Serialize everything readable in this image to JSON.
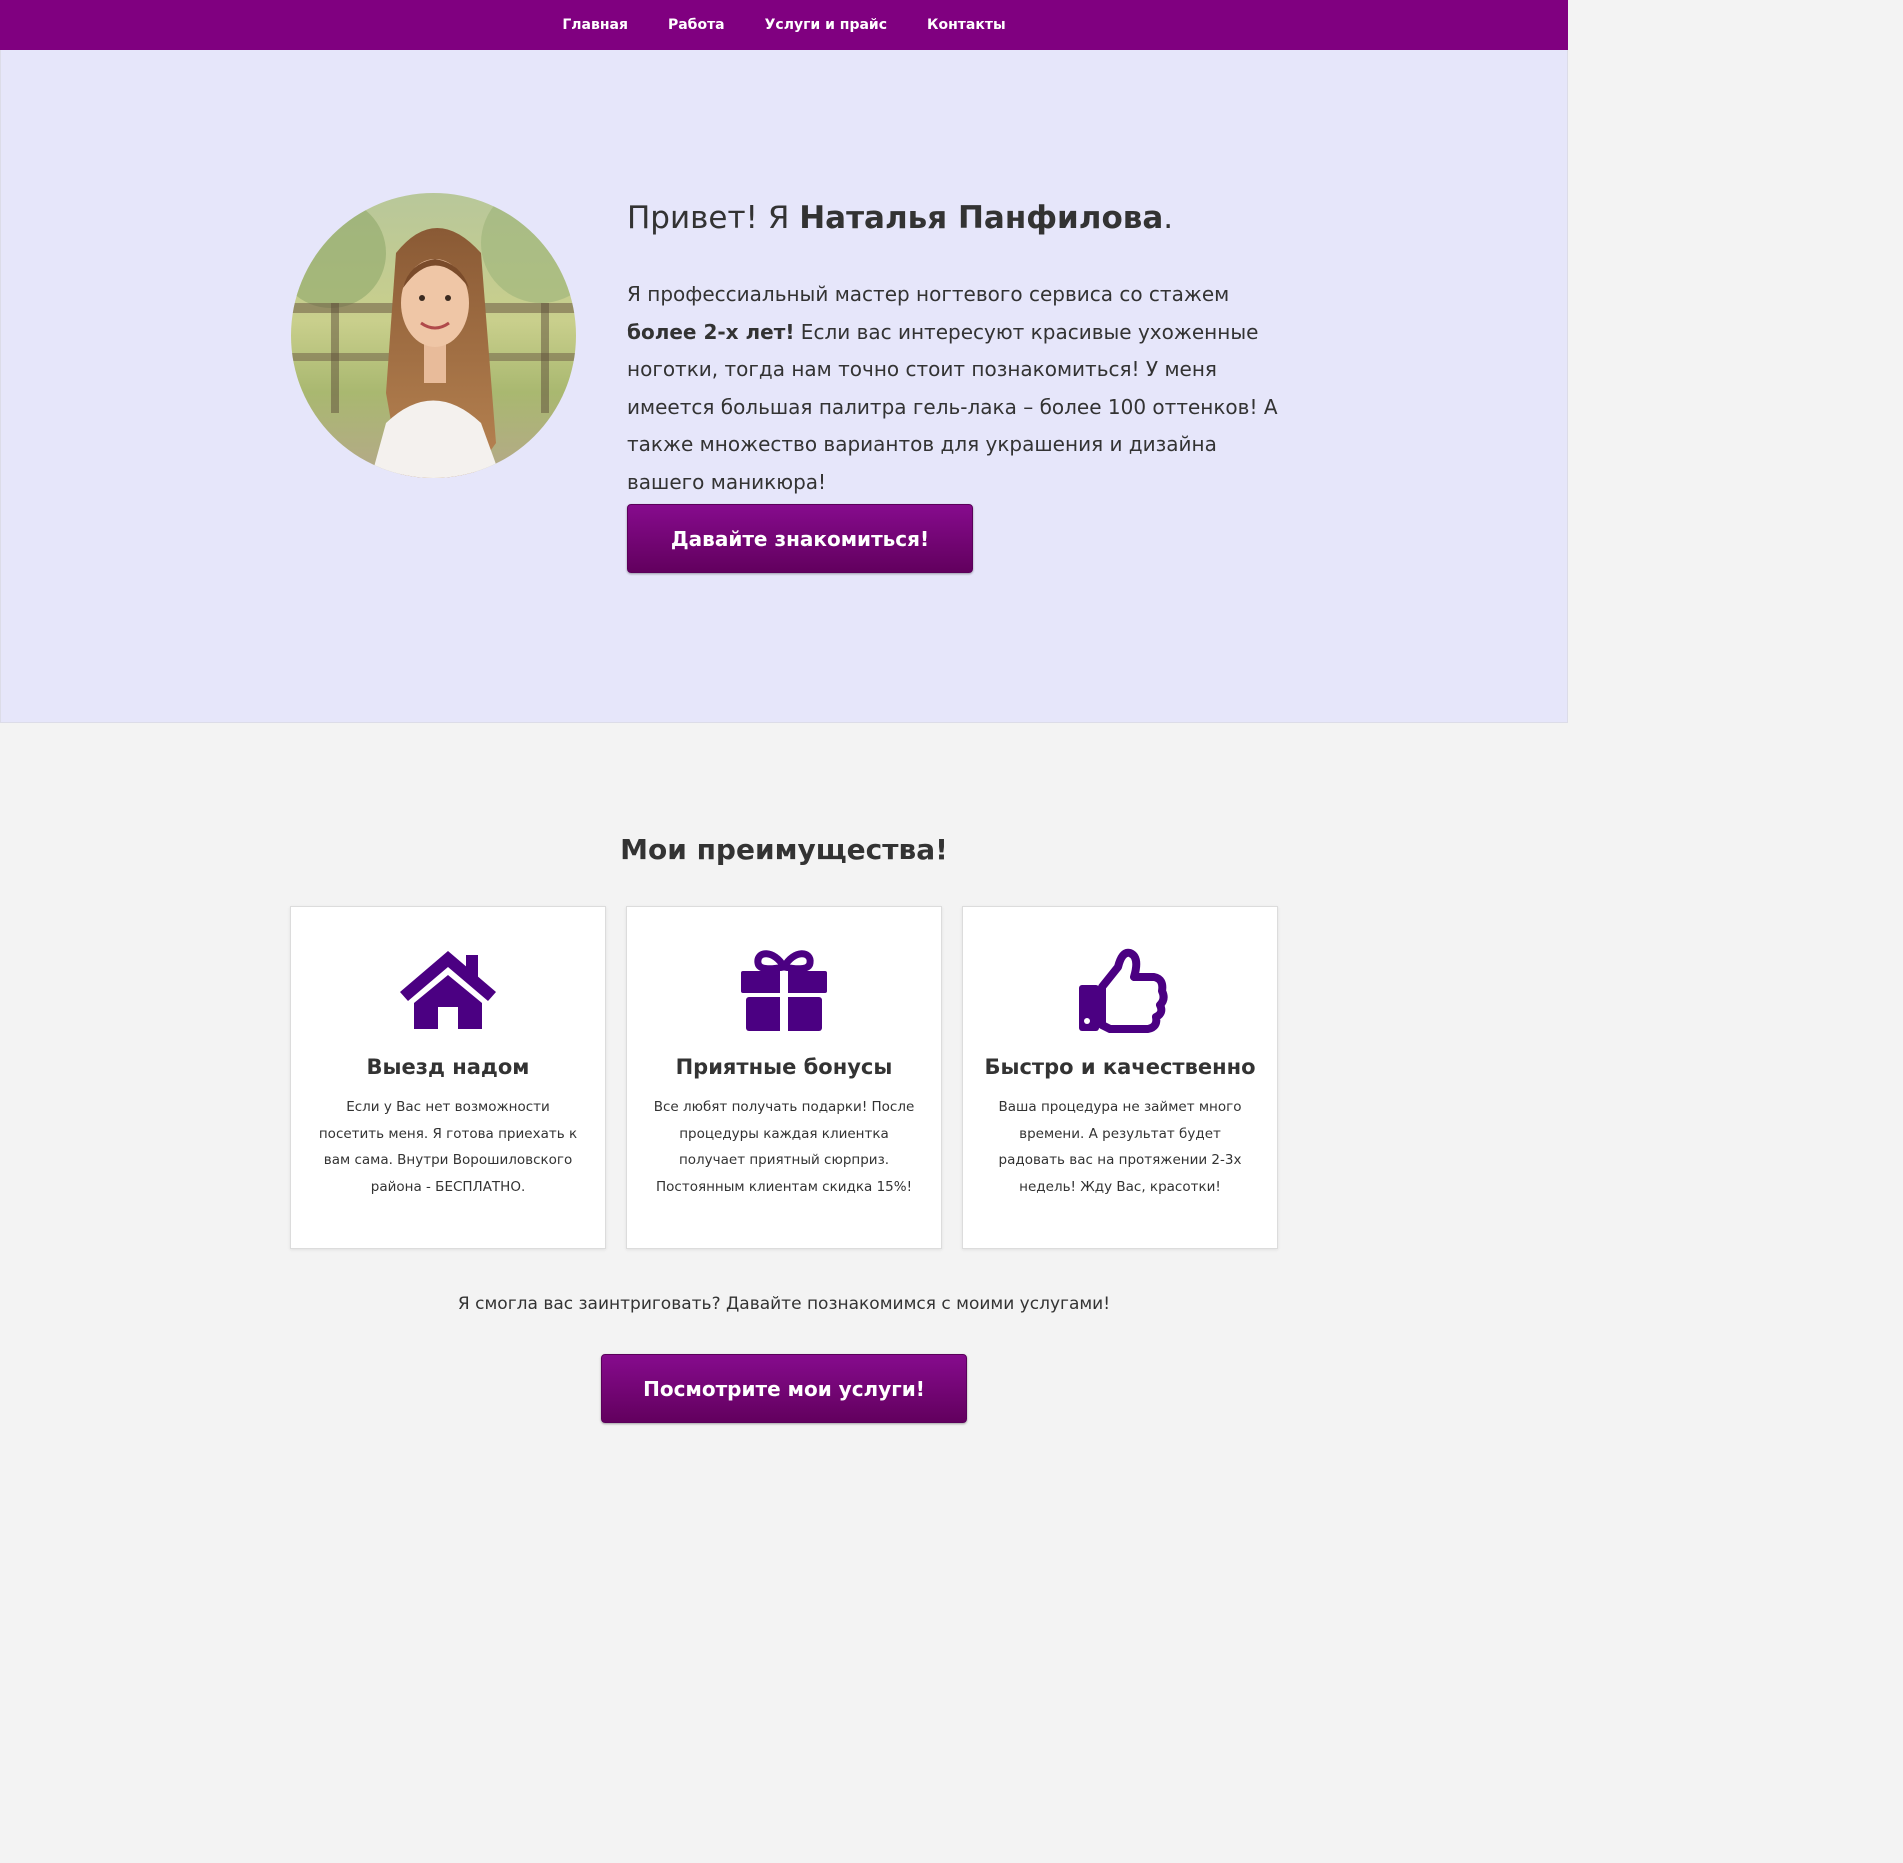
{
  "nav": {
    "items": [
      {
        "label": "Главная"
      },
      {
        "label": "Работа"
      },
      {
        "label": "Услуги и прайс"
      },
      {
        "label": "Контакты"
      }
    ]
  },
  "hero": {
    "greeting": "Привет! Я ",
    "name": "Наталья Панфилова",
    "greeting_end": ".",
    "desc_part1": "Я профессиальный мастер ногтевого сервиса со стажем ",
    "desc_bold": "более 2-х лет!",
    "desc_part2": " Если вас интересуют красивые ухоженные ноготки, тогда нам точно стоит познакомиться! У меня имеется большая палитра гель-лака – более 100 оттенков! А также множество вариантов для украшения и дизайна вашего маникюра!",
    "button_label": "Давайте знакомиться!"
  },
  "features": {
    "title": "Мои преимущества!",
    "cards": [
      {
        "icon": "home-icon",
        "title": "Выезд надом",
        "text": "Если у Вас нет возможности посетить меня. Я готова приехать к вам сама. Внутри Ворошиловского района - БЕСПЛАТНО."
      },
      {
        "icon": "gift-icon",
        "title": "Приятные бонусы",
        "text": "Все любят получать подарки! После процедуры каждая клиентка получает приятный сюрприз. Постоянным клиентам скидка 15%!"
      },
      {
        "icon": "thumbs-up-icon",
        "title": "Быстро и качественно",
        "text": "Ваша процедура не займет много времени. А результат будет радовать вас на протяжении 2-3х недель! Жду Вас, красотки!"
      }
    ],
    "teaser": "Я смогла вас заинтриговать? Давайте познакомимся с моими услугами!",
    "button_label": "Посмотрите мои услуги!"
  },
  "colors": {
    "nav_bg": "#800080",
    "hero_bg": "#e6e6fa",
    "button_gradient_top": "#860b8d",
    "button_gradient_bottom": "#62005e",
    "icon_color": "#4b0082",
    "page_bg": "#f3f3f3"
  }
}
